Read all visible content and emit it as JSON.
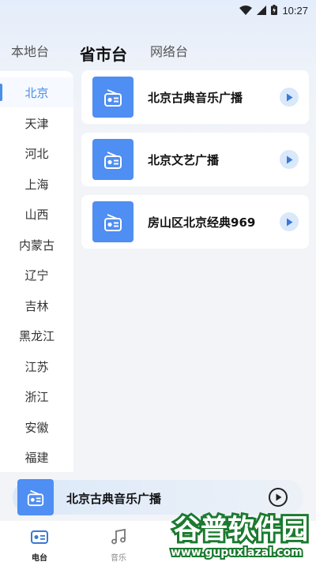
{
  "status_bar": {
    "time": "10:27"
  },
  "tabs": [
    {
      "label": "本地台"
    },
    {
      "label": "省市台"
    },
    {
      "label": "网络台"
    }
  ],
  "sidebar": {
    "items": [
      {
        "label": "北京"
      },
      {
        "label": "天津"
      },
      {
        "label": "河北"
      },
      {
        "label": "上海"
      },
      {
        "label": "山西"
      },
      {
        "label": "内蒙古"
      },
      {
        "label": "辽宁"
      },
      {
        "label": "吉林"
      },
      {
        "label": "黑龙江"
      },
      {
        "label": "江苏"
      },
      {
        "label": "浙江"
      },
      {
        "label": "安徽"
      },
      {
        "label": "福建"
      }
    ]
  },
  "stations": [
    {
      "name": "北京古典音乐广播"
    },
    {
      "name": "北京文艺广播"
    },
    {
      "name": "房山区北京经典969"
    }
  ],
  "player": {
    "title": "北京古典音乐广播"
  },
  "bottom_nav": [
    {
      "label": "电台"
    },
    {
      "label": "音乐"
    }
  ],
  "watermark": {
    "brand": "谷普软件园",
    "url": "www.gupuxlazal.com"
  },
  "colors": {
    "accent": "#4a8fe7",
    "thumb": "#4f8ef2"
  }
}
